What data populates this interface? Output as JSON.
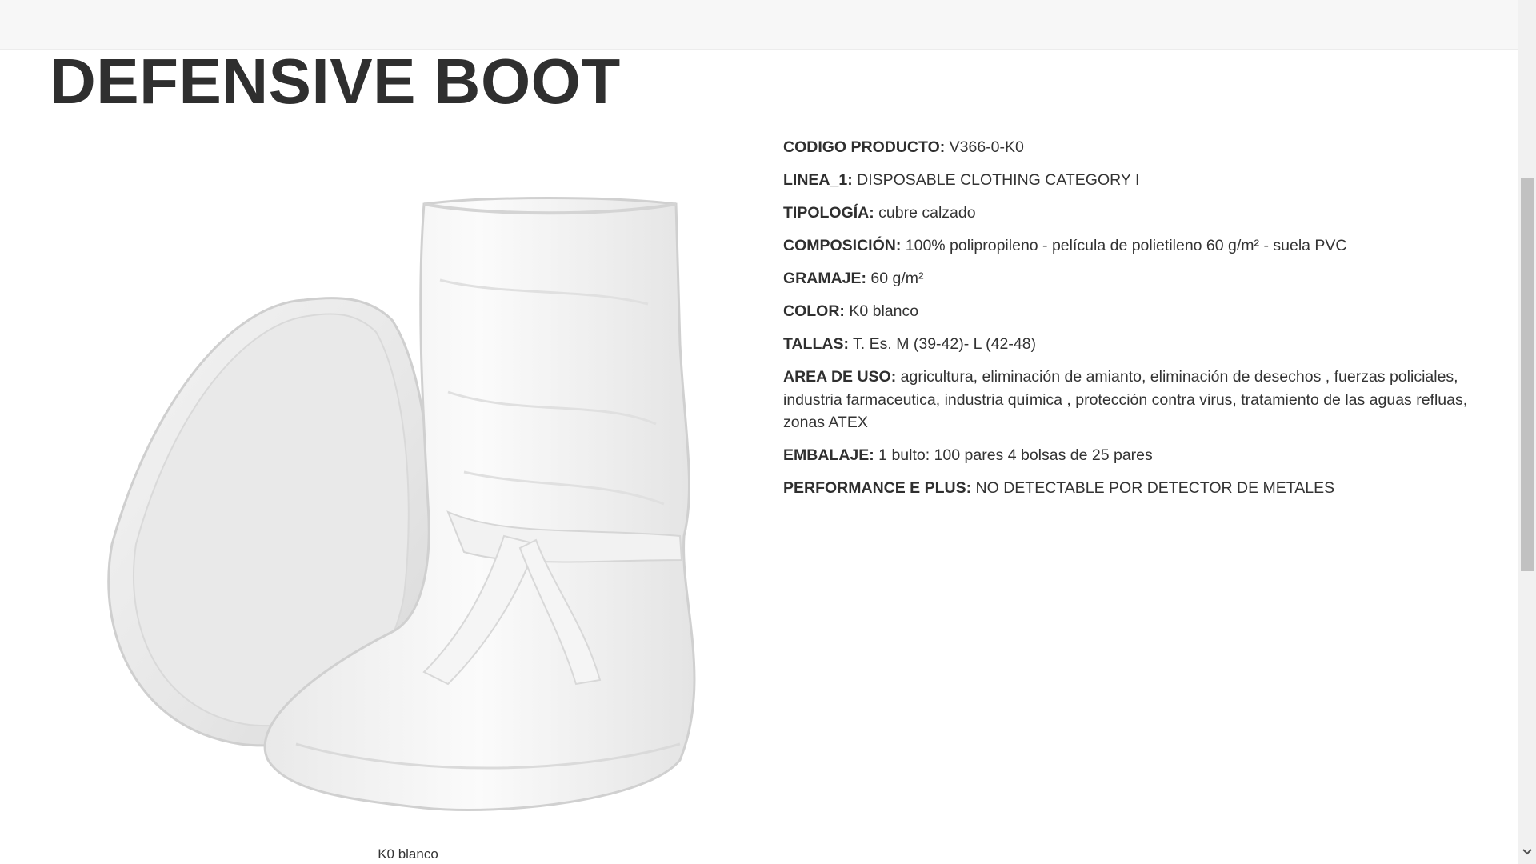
{
  "product": {
    "title": "DEFENSIVE BOOT",
    "image_caption": "K0 blanco",
    "specs": [
      {
        "label": "CODIGO PRODUCTO:",
        "value": " V366-0-K0"
      },
      {
        "label": "LINEA_1:",
        "value": " DISPOSABLE CLOTHING CATEGORY I"
      },
      {
        "label": "TIPOLOGÍA:",
        "value": " cubre calzado"
      },
      {
        "label": "COMPOSICIÓN:",
        "value": " 100% polipropileno - película de polietileno 60 g/m² - suela PVC"
      },
      {
        "label": "GRAMAJE:",
        "value": " 60 g/m²"
      },
      {
        "label": "COLOR:",
        "value": " K0 blanco"
      },
      {
        "label": "TALLAS:",
        "value": " T. Es. M (39-42)- L (42-48)"
      },
      {
        "label": "AREA DE USO:",
        "value": " agricultura, eliminación de amianto, eliminación de desechos , fuerzas policiales, industria farmaceutica, industria química , protección contra virus, tratamiento de las aguas refluas, zonas ATEX"
      },
      {
        "label": "EMBALAJE:",
        "value": " 1 bulto: 100 pares 4 bolsas de 25 pares"
      },
      {
        "label": "PERFORMANCE E PLUS:",
        "value": " NO DETECTABLE POR DETECTOR DE METALES"
      }
    ]
  },
  "scrollbar": {
    "down_arrow": "chevron-down-icon"
  },
  "colors": {
    "text": "#333333",
    "topbar": "#f7f7f7",
    "background": "#ffffff"
  }
}
